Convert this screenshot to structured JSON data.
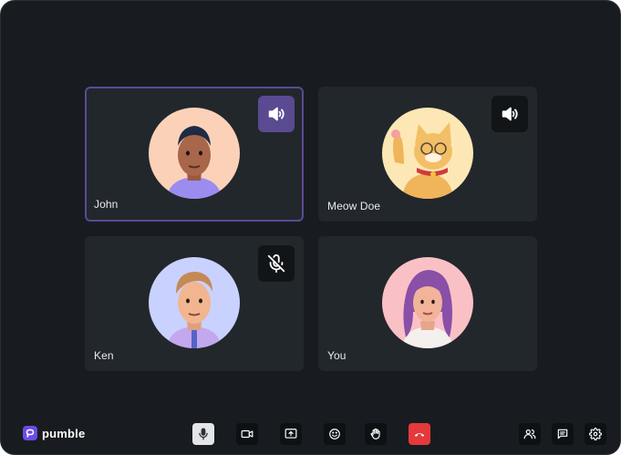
{
  "participants": [
    {
      "name": "John",
      "audio_icon": "speaker-icon",
      "active_speaker": true,
      "avatar_bg": "#fbd2b8"
    },
    {
      "name": "Meow Doe",
      "audio_icon": "speaker-icon",
      "active_speaker": false,
      "avatar_bg": "#fde8b5"
    },
    {
      "name": "Ken",
      "audio_icon": "muted-mic-icon",
      "active_speaker": false,
      "avatar_bg": "#c9d2ff"
    },
    {
      "name": "You",
      "audio_icon": null,
      "active_speaker": false,
      "avatar_bg": "#f9c1c6"
    }
  ],
  "brand": {
    "name": "pumble",
    "color": "#6a4ce6"
  },
  "controls": [
    {
      "icon": "microphone-icon",
      "state": "on"
    },
    {
      "icon": "camera-icon"
    },
    {
      "icon": "share-screen-icon"
    },
    {
      "icon": "emoji-icon"
    },
    {
      "icon": "raise-hand-icon"
    },
    {
      "icon": "leave-call-icon",
      "color": "#e5393b"
    }
  ],
  "right_controls": [
    {
      "icon": "participants-icon"
    },
    {
      "icon": "chat-icon"
    },
    {
      "icon": "settings-icon"
    }
  ],
  "colors": {
    "background": "#181c20",
    "tile": "#22272c",
    "active_border": "#5a4a92"
  }
}
